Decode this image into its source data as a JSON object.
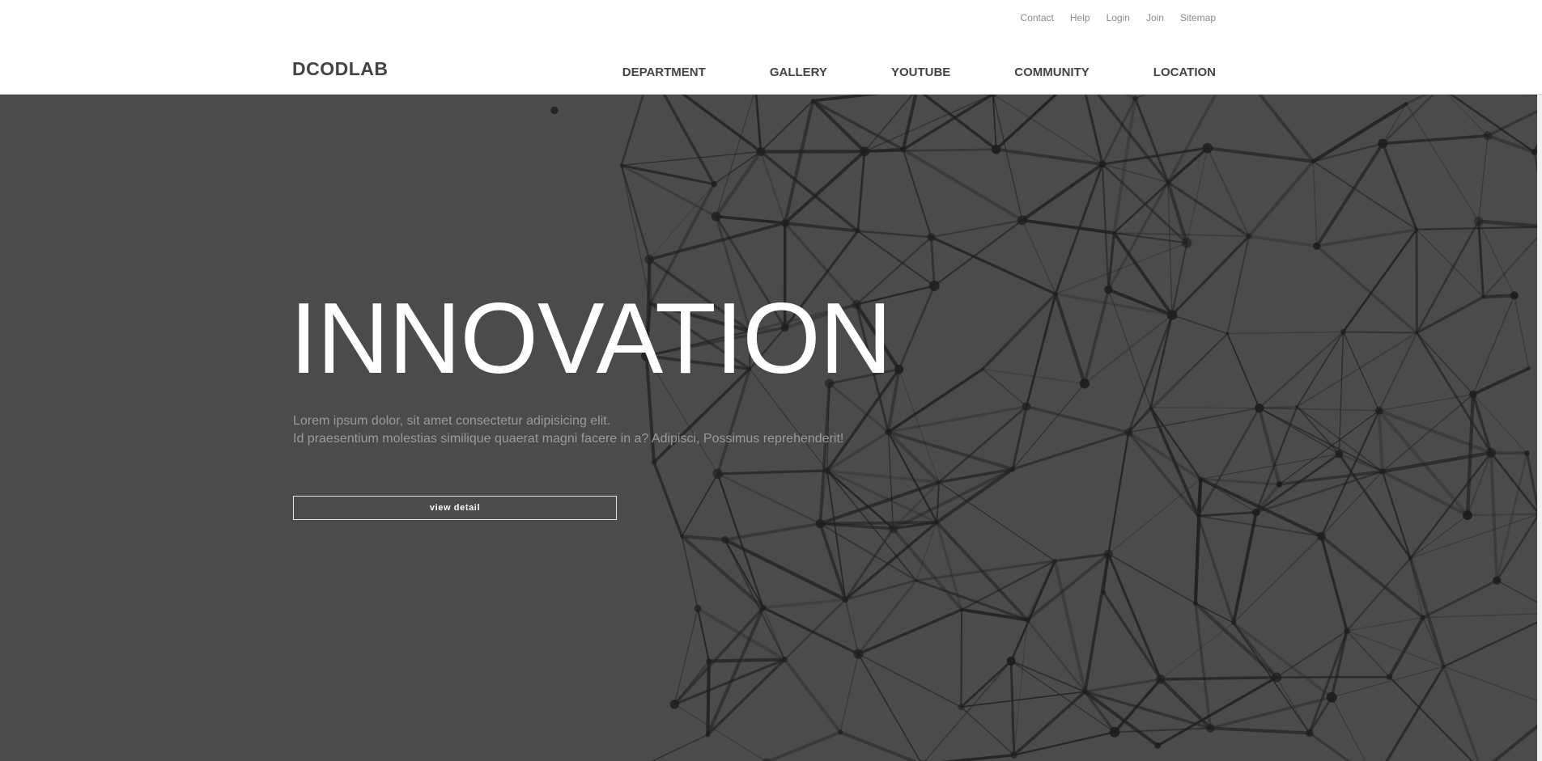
{
  "header": {
    "util_links": [
      "Contact",
      "Help",
      "Login",
      "Join",
      "Sitemap"
    ],
    "logo": "DCODLAB",
    "nav_items": [
      "DEPARTMENT",
      "GALLERY",
      "YOUTUBE",
      "COMMUNITY",
      "LOCATION"
    ]
  },
  "hero": {
    "title": "INNOVATION",
    "desc_line1": "Lorem ipsum dolor, sit amet consectetur adipisicing elit.",
    "desc_line2": "Id praesentium molestias similique quaerat magni facere in a? Adipisci, Possimus reprehenderit!",
    "button_label": "view detail"
  },
  "colors": {
    "hero_bg": "#4b4b4b",
    "network": "#1f1f1f",
    "text_dark": "#444444",
    "text_muted": "#8a8a8a"
  }
}
